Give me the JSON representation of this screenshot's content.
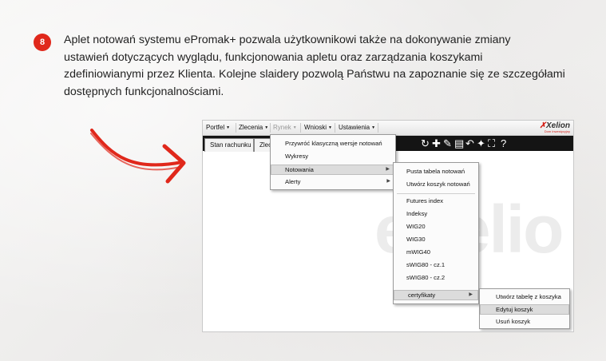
{
  "step": {
    "number": "8"
  },
  "intro": {
    "lines": [
      "Aplet notowań systemu ePromak+ pozwala użytkownikowi także na dokonywanie zmiany",
      "ustawień dotyczących wyglądu, funkcjonowania apletu oraz zarządzania koszykami",
      "zdefiniowianymi przez Klienta. Kolejne slaidery pozwolą Państwu na zapoznanie się ze szczegółami",
      "dostępnych funkcjonalnościami."
    ]
  },
  "app": {
    "menubar": {
      "items": [
        {
          "label": "Portfel"
        },
        {
          "label": "Zlecenia"
        },
        {
          "label": "Rynek"
        },
        {
          "label": "Wnioski"
        },
        {
          "label": "Ustawienia"
        }
      ]
    },
    "logo": {
      "mark": "✗",
      "name": "Xelion",
      "tagline": "Dom Inwestycyjny"
    },
    "tabs": [
      {
        "label": "Stan rachunku"
      },
      {
        "label": "Zlecenia"
      }
    ],
    "toolbar": {
      "icons": [
        {
          "name": "refresh-icon",
          "glyph": "↻"
        },
        {
          "name": "add-icon",
          "glyph": "✚"
        },
        {
          "name": "edit-icon",
          "glyph": "✎"
        },
        {
          "name": "save-icon",
          "glyph": "▤"
        },
        {
          "name": "undo-icon",
          "glyph": "↶"
        },
        {
          "name": "pin-icon",
          "glyph": "✦"
        },
        {
          "name": "fullscreen-icon",
          "glyph": "⛶"
        },
        {
          "name": "help-icon",
          "glyph": "?"
        }
      ]
    },
    "watermark": "eXelio",
    "rynek_menu": {
      "items": [
        {
          "label": "Przywróć klasyczną wersje notowań"
        },
        {
          "label": "Wykresy"
        },
        {
          "label": "Notowania"
        },
        {
          "label": "Alerty"
        }
      ]
    },
    "notowania_menu": {
      "items": [
        {
          "label": "Pusta tabela notowań"
        },
        {
          "label": "Utwórz koszyk notowań"
        },
        {
          "label": "Futures index"
        },
        {
          "label": "Indeksy"
        },
        {
          "label": "WIG20"
        },
        {
          "label": "WIG30"
        },
        {
          "label": "mWIG40"
        },
        {
          "label": "sWIG80 - cz.1"
        },
        {
          "label": "sWIG80 - cz.2"
        },
        {
          "label": "certyfikaty"
        }
      ]
    },
    "certyfikaty_menu": {
      "items": [
        {
          "label": "Utwórz tabelę z koszyka"
        },
        {
          "label": "Edytuj koszyk"
        },
        {
          "label": "Usuń koszyk"
        }
      ]
    }
  },
  "colors": {
    "accent_red": "#e0281b",
    "tabbar_dark": "#141414",
    "menu_highlight": "#dcdcdc"
  }
}
